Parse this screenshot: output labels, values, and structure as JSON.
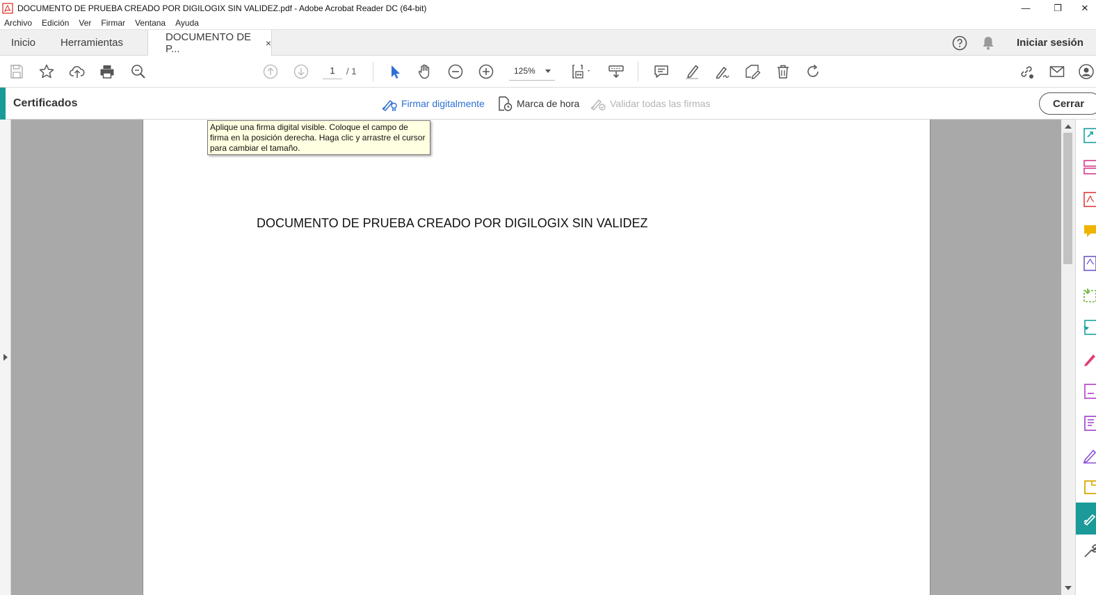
{
  "window": {
    "title": "DOCUMENTO DE PRUEBA CREADO POR DIGILOGIX SIN VALIDEZ.pdf - Adobe Acrobat Reader DC (64-bit)",
    "minimize": "—",
    "restore": "❐",
    "close": "✕"
  },
  "menu": [
    "Archivo",
    "Edición",
    "Ver",
    "Firmar",
    "Ventana",
    "Ayuda"
  ],
  "tabs": {
    "home": "Inicio",
    "tools": "Herramientas",
    "document": "DOCUMENTO DE P...",
    "close_glyph": "×"
  },
  "header_right": {
    "signin": "Iniciar sesión",
    "help_icon": "help-icon",
    "bell_icon": "bell-icon"
  },
  "toolbar": {
    "page_current": "1",
    "page_total": "/  1",
    "zoom": "125%"
  },
  "certificates": {
    "panel_title": "Certificados",
    "sign_digitally": "Firmar digitalmente",
    "timestamp": "Marca de hora",
    "validate_all": "Validar todas las firmas",
    "close": "Cerrar"
  },
  "tooltip": {
    "text": "Aplique una firma digital visible. Coloque el campo de firma en la posición derecha. Haga clic y arrastre el cursor para cambiar el tamaño."
  },
  "document": {
    "body_text": "DOCUMENTO DE PRUEBA CREADO POR DIGILOGIX SIN VALIDEZ"
  },
  "colors": {
    "accent_teal": "#1a9a98",
    "link_blue": "#2d6fd3",
    "tooltip_bg": "#ffffe1",
    "doc_bg": "#a9a9a9"
  }
}
